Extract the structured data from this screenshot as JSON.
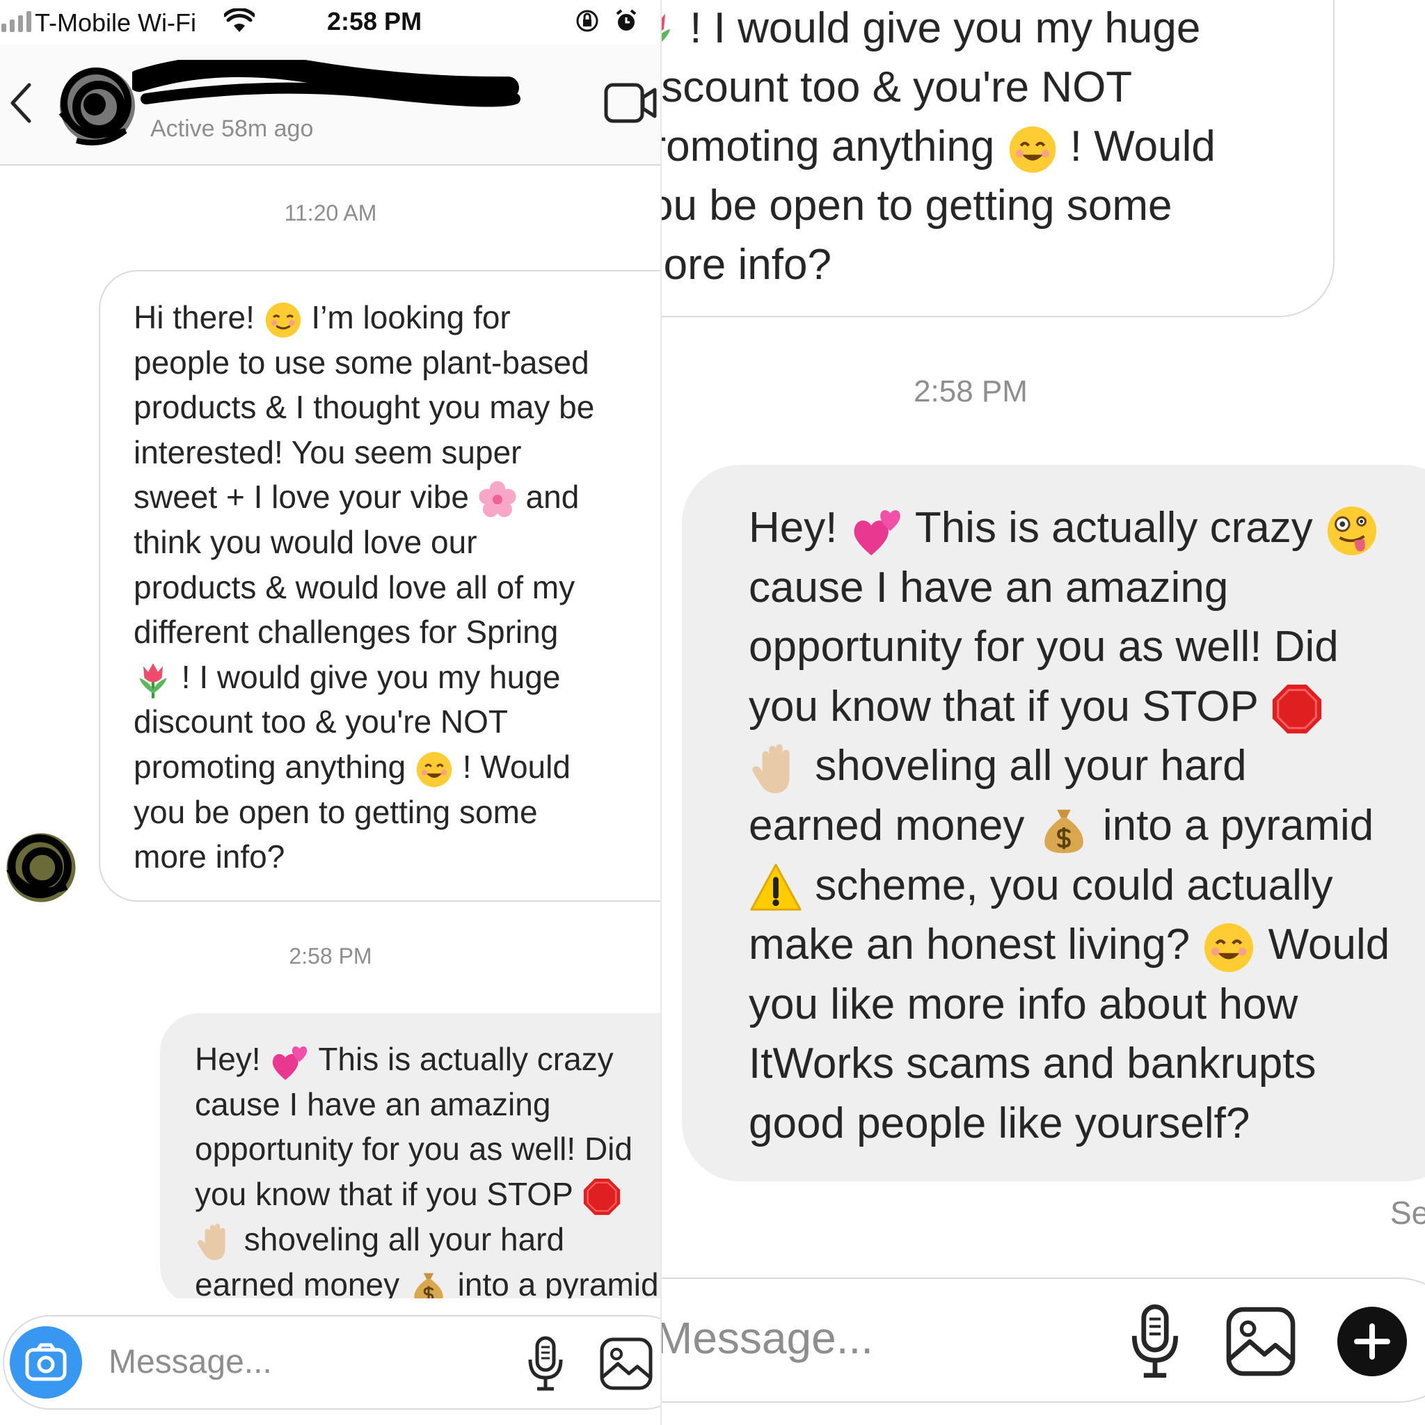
{
  "status_bar": {
    "carrier": "T-Mobile Wi-Fi",
    "time": "2:58 PM"
  },
  "header": {
    "active_status": "Active 58m ago"
  },
  "timestamps": {
    "first": "11:20 AM",
    "second": "2:58 PM"
  },
  "incoming_message": {
    "lines": [
      "Hi there! [relieved-face] I'm looking for",
      "people to use some plant-based",
      "products & I thought you may be",
      "interested! You seem super",
      "sweet + I love your vibe [cherry-blossom] and",
      "think you would love our",
      "products & would love all of my",
      "different challenges for Spring",
      "[tulip] ! I would give you my huge",
      "discount too & you're NOT",
      "promoting anything [smiling-face] ! Would",
      "you be open to getting some",
      "more info?"
    ]
  },
  "outgoing_message": {
    "lines": [
      "Hey! [two-hearts] This is actually crazy [zany-face]",
      "cause I have an amazing",
      "opportunity for you as well! Did",
      "you know that if you STOP [stop-sign]",
      "[raised-hand] shoveling all your hard",
      "earned money [money-bag] into a pyramid",
      "[warning] scheme, you could actually",
      "make an honest living? [smiling-face] Would",
      "you like more info about how",
      "ItWorks scams and bankrupts",
      "good people like yourself?"
    ]
  },
  "right_panel": {
    "top_fragment": [
      "[tulip] ! I would give you my huge",
      "discount too & you're NOT",
      "promoting anything [smiling-face] ! Would",
      "you be open to getting some",
      "more info?"
    ],
    "timestamp": "2:58 PM",
    "seen_label": "Seen"
  },
  "composer": {
    "placeholder": "Message..."
  },
  "icons": [
    "signal-icon",
    "wifi-icon",
    "orientation-lock-icon",
    "alarm-icon",
    "back-chevron-icon",
    "video-call-icon",
    "camera-icon",
    "microphone-icon",
    "gallery-icon",
    "plus-icon",
    "relieved-face-emoji",
    "cherry-blossom-emoji",
    "tulip-emoji",
    "smiling-face-emoji",
    "two-hearts-emoji",
    "zany-face-emoji",
    "stop-sign-emoji",
    "raised-hand-emoji",
    "money-bag-emoji",
    "warning-emoji"
  ],
  "colors": {
    "accent_blue": "#3897f0",
    "bubble_grey": "#efefef",
    "border": "#dbdbdb",
    "secondary_text": "#8e8e8e"
  }
}
